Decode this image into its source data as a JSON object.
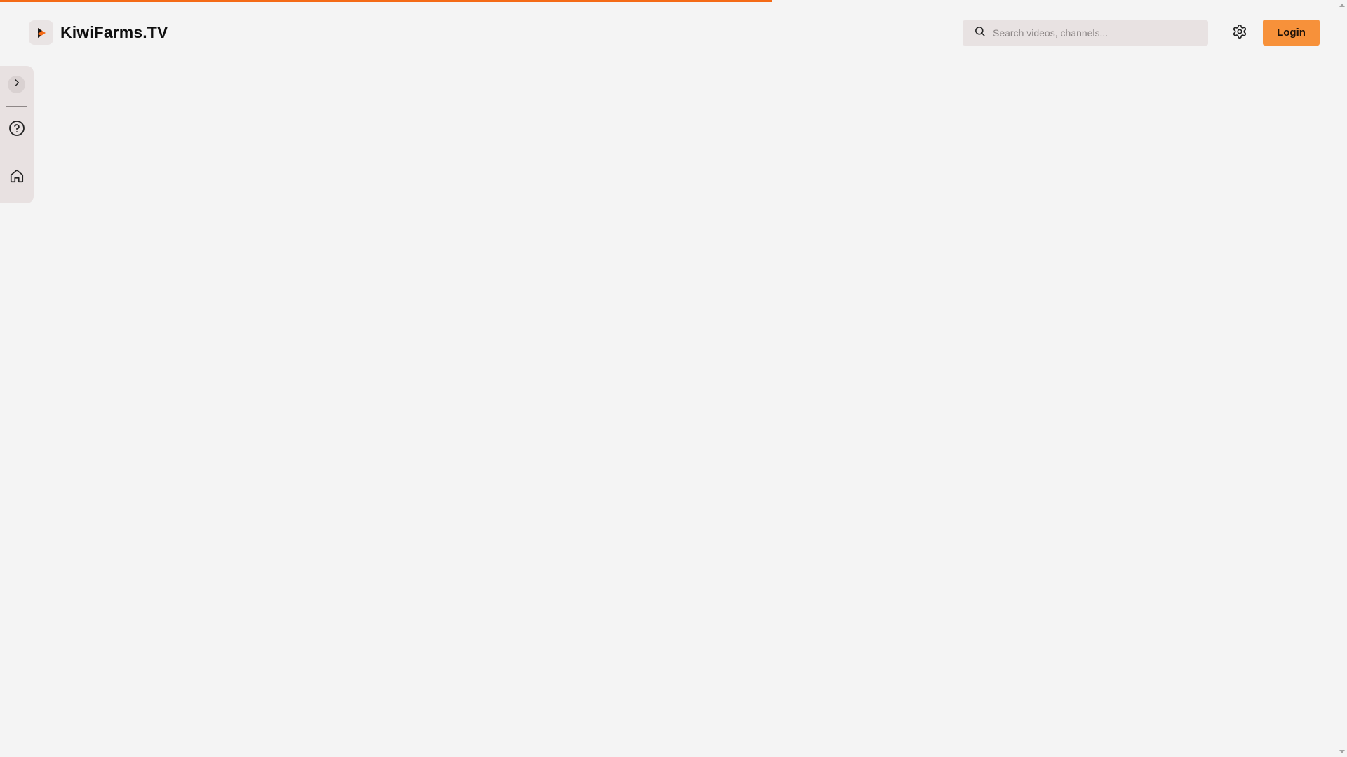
{
  "loading_bar": {
    "progress_percent": 57.3,
    "color": "#f46a16"
  },
  "header": {
    "logo_text": "KiwiFarms.TV",
    "logo_icon": "play-logo-icon",
    "search": {
      "placeholder": "Search videos, channels...",
      "value": "",
      "icon": "search-icon"
    },
    "settings_icon": "gear-icon",
    "login_label": "Login",
    "accent_color": "#f7913a"
  },
  "sidebar": {
    "items": [
      {
        "icon": "chevron-right-icon",
        "label": "Expand sidebar"
      },
      {
        "icon": "help-circle-icon",
        "label": "Help"
      },
      {
        "icon": "home-icon",
        "label": "Home"
      }
    ]
  }
}
